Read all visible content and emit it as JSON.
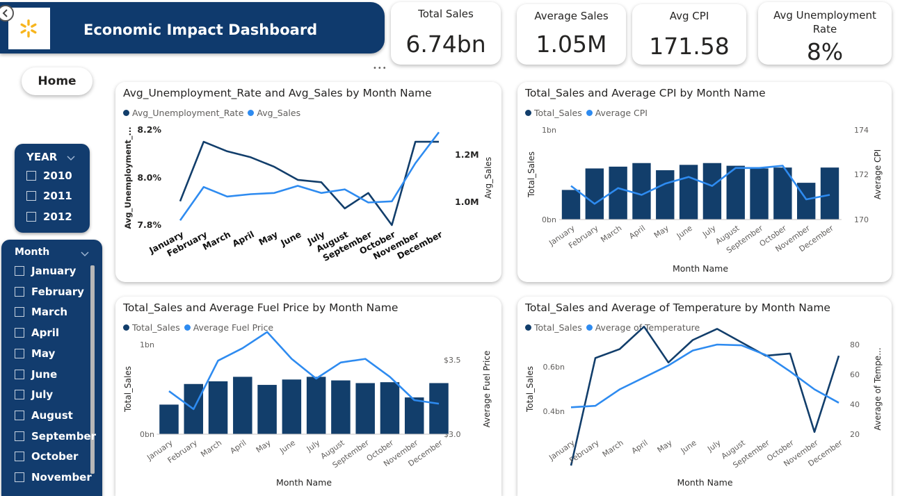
{
  "header": {
    "title": "Economic Impact Dashboard",
    "logo": "walmart-spark-logo"
  },
  "nav": {
    "home_label": "Home",
    "more_label": "•••"
  },
  "kpis": [
    {
      "title": "Total Sales",
      "value": "6.74bn"
    },
    {
      "title": "Average Sales",
      "value": "1.05M"
    },
    {
      "title": "Avg CPI",
      "value": "171.58"
    },
    {
      "title": "Avg Unemployment Rate",
      "value": "8%"
    }
  ],
  "year_slicer": {
    "title": "YEAR",
    "items": [
      "2010",
      "2011",
      "2012"
    ]
  },
  "month_slicer": {
    "title": "Month",
    "items": [
      "January",
      "February",
      "March",
      "April",
      "May",
      "June",
      "July",
      "August",
      "September",
      "October",
      "November"
    ]
  },
  "colors": {
    "navy": "#0f3a6d",
    "dark_series": "#123e6b",
    "light_series": "#2e8bf0",
    "bar": "#123e6b"
  },
  "chart_data": [
    {
      "type": "line",
      "title": "Avg_Unemployment_Rate and Avg_Sales by Month Name",
      "x": [
        "January",
        "February",
        "March",
        "April",
        "May",
        "June",
        "July",
        "August",
        "September",
        "October",
        "November",
        "December"
      ],
      "xlabel": "",
      "y_left_label": "Avg_Unemployment_...",
      "y_right_label": "Avg_Sales",
      "left_ticks": [
        "8.2%",
        "8.0%",
        "7.8%"
      ],
      "right_ticks": [
        "1.2M",
        "1.0M"
      ],
      "left_range": [
        7.8,
        8.2
      ],
      "right_range": [
        0.9,
        1.3
      ],
      "series": [
        {
          "name": "Avg_Unemployment_Rate",
          "axis": "left",
          "values": [
            7.9,
            8.15,
            8.11,
            8.085,
            8.045,
            7.99,
            7.98,
            7.87,
            7.935,
            7.8,
            8.15,
            8.15
          ]
        },
        {
          "name": "Avg_Sales",
          "axis": "right",
          "values": [
            0.92,
            1.06,
            1.02,
            1.03,
            1.035,
            1.065,
            1.035,
            1.05,
            0.995,
            1.0,
            1.16,
            1.29
          ]
        }
      ]
    },
    {
      "type": "bar",
      "title": "Total_Sales and Average CPI by Month Name",
      "categories": [
        "January",
        "February",
        "March",
        "April",
        "May",
        "June",
        "July",
        "August",
        "September",
        "October",
        "November",
        "December"
      ],
      "xlabel": "Month Name",
      "y_left_label": "Total_Sales",
      "y_right_label": "Average CPI",
      "left_ticks": [
        "1bn",
        "0bn"
      ],
      "right_ticks": [
        "174",
        "172",
        "170"
      ],
      "left_range": [
        0,
        1
      ],
      "right_range": [
        170,
        174
      ],
      "series": [
        {
          "name": "Total_Sales",
          "axis": "left",
          "kind": "bar",
          "values": [
            0.33,
            0.57,
            0.59,
            0.63,
            0.55,
            0.61,
            0.63,
            0.6,
            0.57,
            0.58,
            0.41,
            0.58
          ]
        },
        {
          "name": "Average CPI",
          "axis": "right",
          "kind": "line",
          "values": [
            171.5,
            170.7,
            171.4,
            171.1,
            171.6,
            171.9,
            171.5,
            172.3,
            172.3,
            172.4,
            170.9,
            171.1
          ]
        }
      ]
    },
    {
      "type": "bar",
      "title": "Total_Sales and Average Fuel Price by Month Name",
      "categories": [
        "January",
        "February",
        "March",
        "April",
        "May",
        "June",
        "July",
        "August",
        "September",
        "October",
        "November",
        "December"
      ],
      "xlabel": "Month Name",
      "y_left_label": "Total_Sales",
      "y_right_label": "Average Fuel Price",
      "left_ticks": [
        "1bn",
        "0bn"
      ],
      "right_ticks": [
        "$3.5",
        "$3.0"
      ],
      "left_range": [
        0,
        1
      ],
      "right_range": [
        3.0,
        3.5
      ],
      "series": [
        {
          "name": "Total_Sales",
          "axis": "left",
          "kind": "bar",
          "values": [
            0.33,
            0.56,
            0.59,
            0.64,
            0.55,
            0.61,
            0.64,
            0.6,
            0.57,
            0.58,
            0.41,
            0.57
          ]
        },
        {
          "name": "Average Fuel Price",
          "axis": "right",
          "kind": "line",
          "values": [
            3.24,
            3.14,
            3.41,
            3.48,
            3.57,
            3.42,
            3.31,
            3.4,
            3.42,
            3.32,
            3.19,
            3.17
          ]
        }
      ]
    },
    {
      "type": "line",
      "title": "Total_Sales and Average of Temperature by Month Name",
      "x": [
        "January",
        "February",
        "March",
        "April",
        "May",
        "June",
        "July",
        "August",
        "September",
        "October",
        "November",
        "December"
      ],
      "xlabel": "Month Name",
      "y_left_label": "Total_Sales",
      "y_right_label": "Average of Tempe...",
      "left_ticks": [
        "0.6bn",
        "0.4bn"
      ],
      "right_ticks": [
        "80",
        "60",
        "40",
        "20"
      ],
      "left_range": [
        0.4,
        0.6
      ],
      "right_range": [
        20,
        80
      ],
      "series": [
        {
          "name": "Total_Sales",
          "axis": "left",
          "values": [
            0.33,
            0.57,
            0.59,
            0.64,
            0.56,
            0.61,
            0.635,
            0.605,
            0.575,
            0.58,
            0.405,
            0.575
          ]
        },
        {
          "name": "Average of Temperature",
          "axis": "right",
          "values": [
            38,
            39,
            50,
            58,
            66,
            76,
            80,
            79.5,
            73,
            62,
            50,
            41
          ]
        }
      ]
    }
  ]
}
